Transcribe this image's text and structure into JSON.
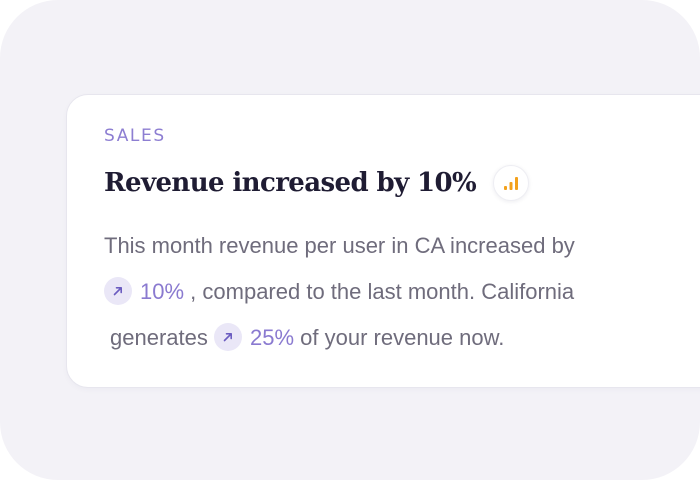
{
  "insight": {
    "eyebrow": "SALES",
    "title": "Revenue increased by 10%",
    "chart_icon": "bar-chart-icon",
    "body": {
      "line1": "This month revenue per user in CA increased by",
      "increase1": "10%",
      "line2_after": ", compared to the last month. California",
      "line3_before": "generates",
      "increase2": "25%",
      "line3_after": "of your revenue now."
    },
    "arrow_icon": "arrow-up-right-icon"
  },
  "colors": {
    "panel_bg": "#f3f2f7",
    "card_bg": "#ffffff",
    "accent": "#8a7ad0",
    "title": "#1f1c33",
    "body": "#6f6c7c",
    "chart_orange": "#f3a11c"
  }
}
